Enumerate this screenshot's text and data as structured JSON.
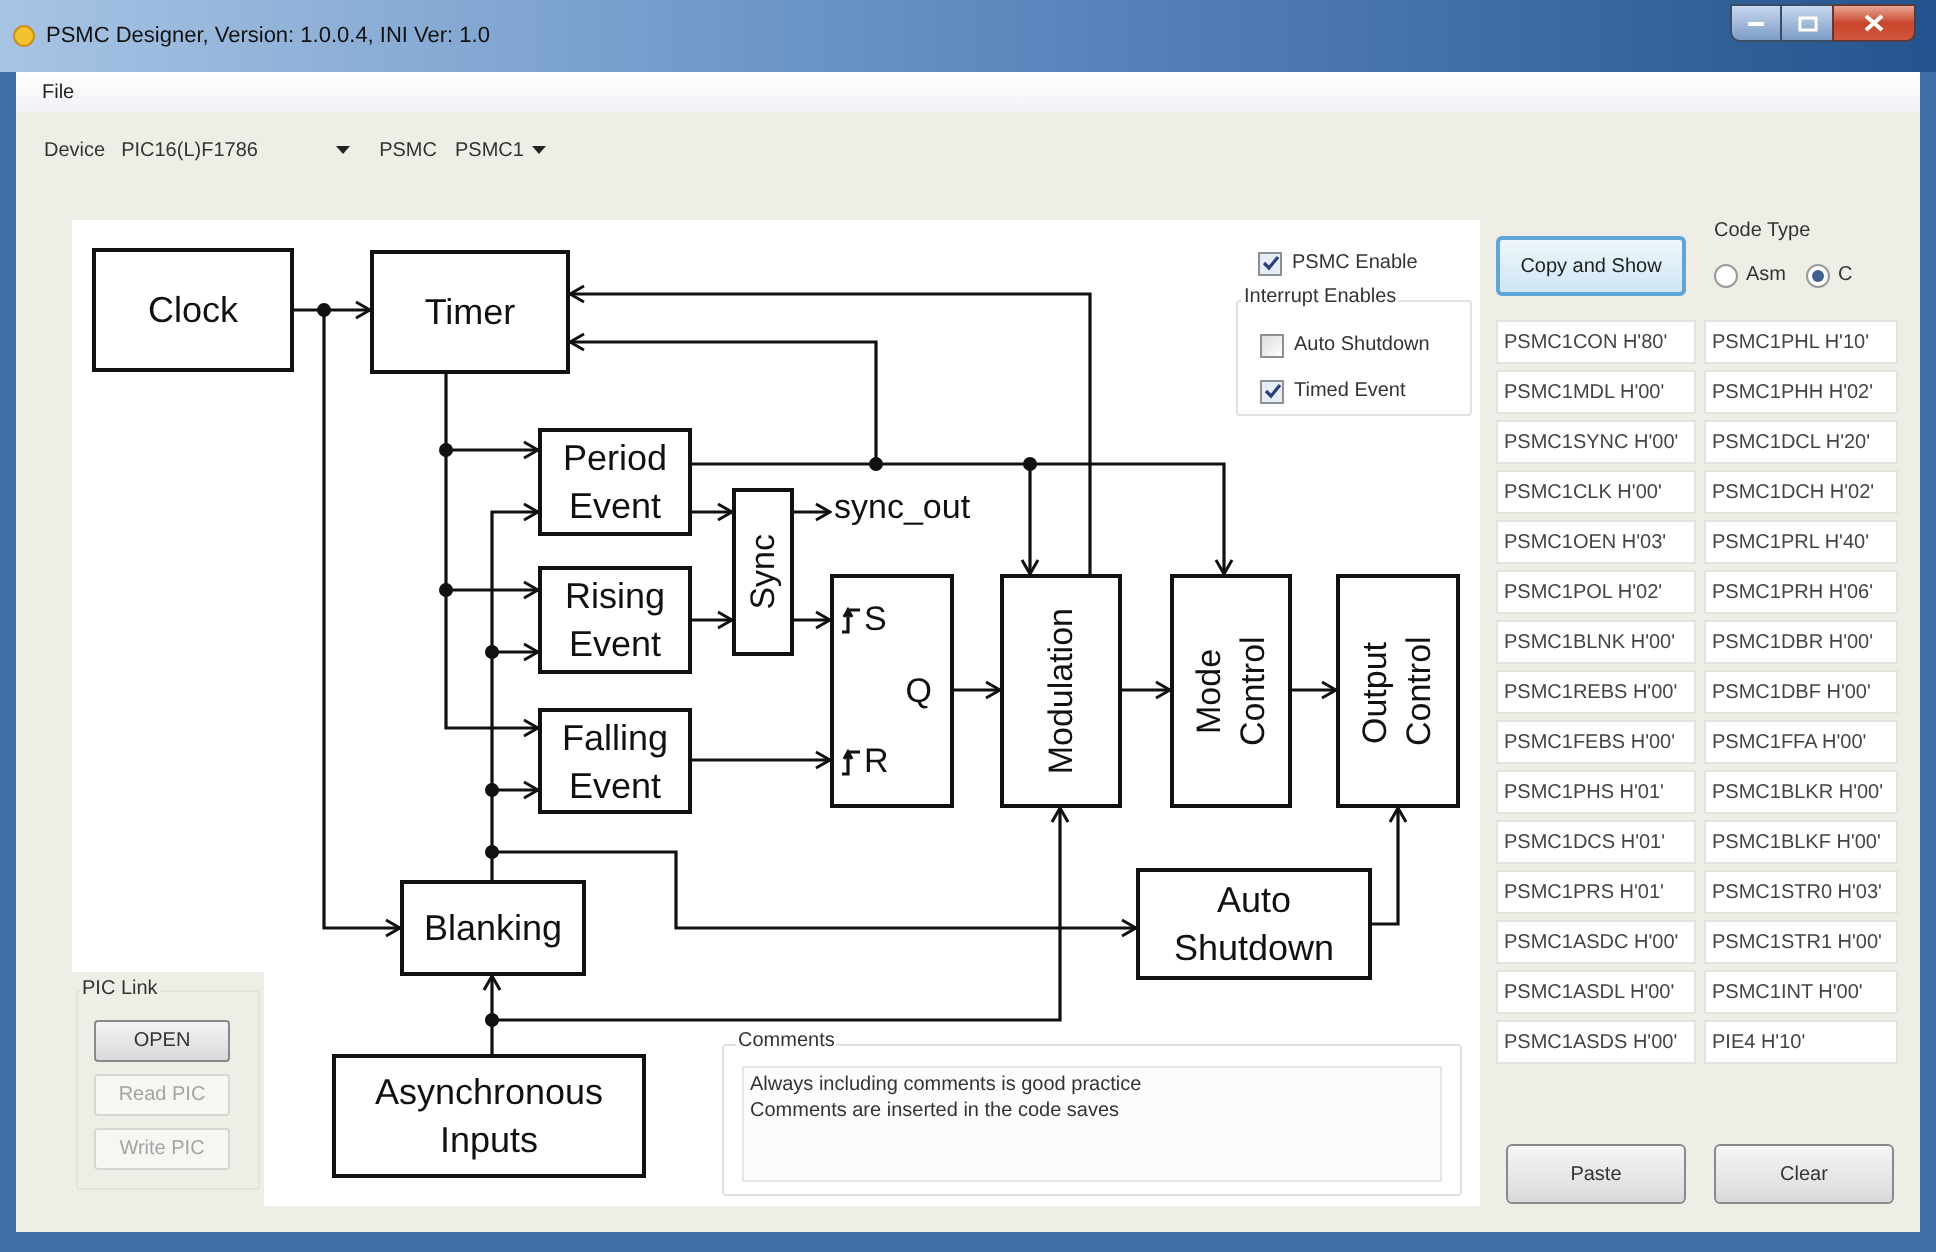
{
  "window": {
    "title": "PSMC Designer, Version: 1.0.0.4, INI Ver: 1.0"
  },
  "menu": [
    "File"
  ],
  "toolbar": {
    "device": {
      "label": "Device",
      "value": "PIC16(L)F1786"
    },
    "psmc": {
      "label": "PSMC",
      "value": "PSMC1"
    }
  },
  "diagram": {
    "nodes": [
      {
        "kind": "block",
        "label": "Clock"
      },
      {
        "kind": "block",
        "label": "Timer"
      },
      {
        "kind": "block",
        "label": "Period Event"
      },
      {
        "kind": "vertical",
        "label": "Sync"
      },
      {
        "kind": "label",
        "label": "sync_out"
      },
      {
        "kind": "block",
        "label": "Rising Event"
      },
      {
        "kind": "block",
        "label": "Falling Event"
      },
      {
        "kind": "flipflop",
        "pins": [
          {
            "kind": "edge",
            "label": "S"
          },
          {
            "kind": "output",
            "label": "Q"
          },
          {
            "kind": "edge",
            "label": "R"
          }
        ]
      },
      {
        "kind": "vertical",
        "label": "Modulation"
      },
      {
        "kind": "vertical",
        "label": "Mode Control"
      },
      {
        "kind": "vertical",
        "label": "Output Control"
      },
      {
        "kind": "block",
        "label": "Blanking"
      },
      {
        "kind": "block",
        "label": "Auto Shutdown"
      },
      {
        "kind": "block",
        "label": "Asynchronous Inputs"
      }
    ]
  },
  "enable": {
    "label": "PSMC Enable",
    "checked": true
  },
  "interrupt_enables": {
    "title": "Interrupt Enables",
    "items": [
      {
        "label": "Auto Shutdown",
        "checked": false
      },
      {
        "label": "Timed Event",
        "checked": true
      }
    ]
  },
  "pic_link": {
    "title": "PIC Link",
    "buttons": [
      {
        "label": "OPEN",
        "disabled": false
      },
      {
        "label": "Read PIC",
        "disabled": true
      },
      {
        "label": "Write PIC",
        "disabled": true
      }
    ]
  },
  "comments": {
    "title": "Comments",
    "lines": [
      "Always including comments is good practice",
      "Comments are inserted in the code saves"
    ]
  },
  "copy_button": "Copy and Show",
  "code_type": {
    "title": "Code Type",
    "options": [
      {
        "label": "Asm",
        "selected": false
      },
      {
        "label": "C",
        "selected": true
      }
    ]
  },
  "registers": [
    [
      "PSMC1CON H'80'",
      "PSMC1PHL H'10'"
    ],
    [
      "PSMC1MDL H'00'",
      "PSMC1PHH H'02'"
    ],
    [
      "PSMC1SYNC H'00'",
      "PSMC1DCL H'20'"
    ],
    [
      "PSMC1CLK H'00'",
      "PSMC1DCH H'02'"
    ],
    [
      "PSMC1OEN H'03'",
      "PSMC1PRL H'40'"
    ],
    [
      "PSMC1POL H'02'",
      "PSMC1PRH H'06'"
    ],
    [
      "PSMC1BLNK H'00'",
      "PSMC1DBR H'00'"
    ],
    [
      "PSMC1REBS H'00'",
      "PSMC1DBF H'00'"
    ],
    [
      "PSMC1FEBS H'00'",
      "PSMC1FFA H'00'"
    ],
    [
      "PSMC1PHS H'01'",
      "PSMC1BLKR H'00'"
    ],
    [
      "PSMC1DCS H'01'",
      "PSMC1BLKF H'00'"
    ],
    [
      "PSMC1PRS H'01'",
      "PSMC1STR0 H'03'"
    ],
    [
      "PSMC1ASDC H'00'",
      "PSMC1STR1 H'00'"
    ],
    [
      "PSMC1ASDL H'00'",
      "PSMC1INT H'00'"
    ],
    [
      "PSMC1ASDS H'00'",
      "PIE4 H'10'"
    ]
  ],
  "actions": [
    "Paste",
    "Clear"
  ]
}
